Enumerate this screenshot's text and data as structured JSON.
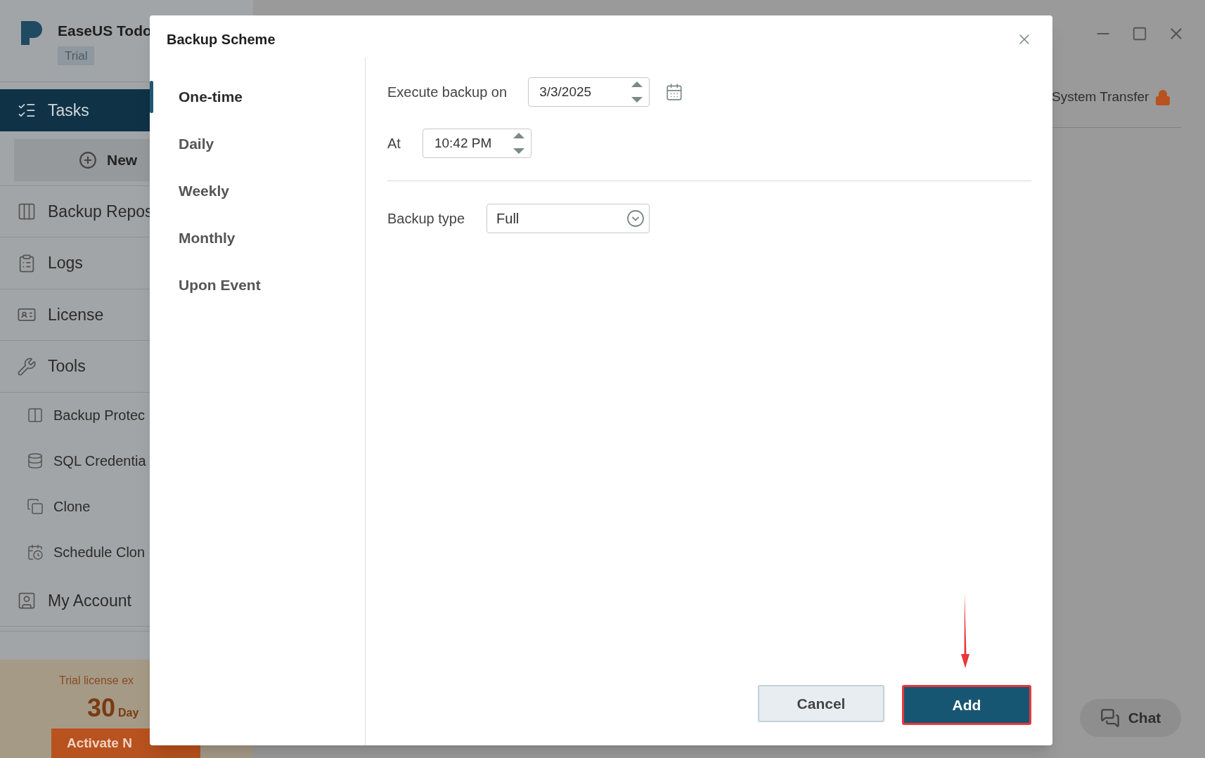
{
  "app": {
    "name": "EaseUS Todo",
    "badge": "Trial"
  },
  "sidebar": {
    "nav": [
      {
        "label": "Tasks",
        "kind": "main",
        "selected": true
      },
      {
        "label": "New",
        "kind": "action",
        "selected": false
      },
      {
        "label": "Backup Repos",
        "kind": "main",
        "selected": false
      },
      {
        "label": "Logs",
        "kind": "main",
        "selected": false
      },
      {
        "label": "License",
        "kind": "main",
        "selected": false
      },
      {
        "label": "Tools",
        "kind": "main",
        "selected": false
      },
      {
        "label": "Backup Protec",
        "kind": "sub",
        "selected": false
      },
      {
        "label": "SQL Credentia",
        "kind": "sub",
        "selected": false
      },
      {
        "label": "Clone",
        "kind": "sub",
        "selected": false
      },
      {
        "label": "Schedule Clon",
        "kind": "sub",
        "selected": false
      },
      {
        "label": "My Account",
        "kind": "main",
        "selected": false
      }
    ],
    "trial": {
      "message": "Trial license ex",
      "days": "30",
      "unit": "Day",
      "button": "Activate N"
    }
  },
  "header": {
    "tab": "System Transfer",
    "locked": true
  },
  "chat": "Chat",
  "dialog": {
    "title": "Backup Scheme",
    "schedule_options": [
      {
        "label": "One-time",
        "selected": true
      },
      {
        "label": "Daily",
        "selected": false
      },
      {
        "label": "Weekly",
        "selected": false
      },
      {
        "label": "Monthly",
        "selected": false
      },
      {
        "label": "Upon Event",
        "selected": false
      }
    ],
    "execute_label": "Execute backup on",
    "date": "3/3/2025",
    "at_label": "At",
    "time": "10:42 PM",
    "backup_type_label": "Backup type",
    "backup_type": "Full",
    "buttons": {
      "cancel": "Cancel",
      "add": "Add"
    }
  }
}
